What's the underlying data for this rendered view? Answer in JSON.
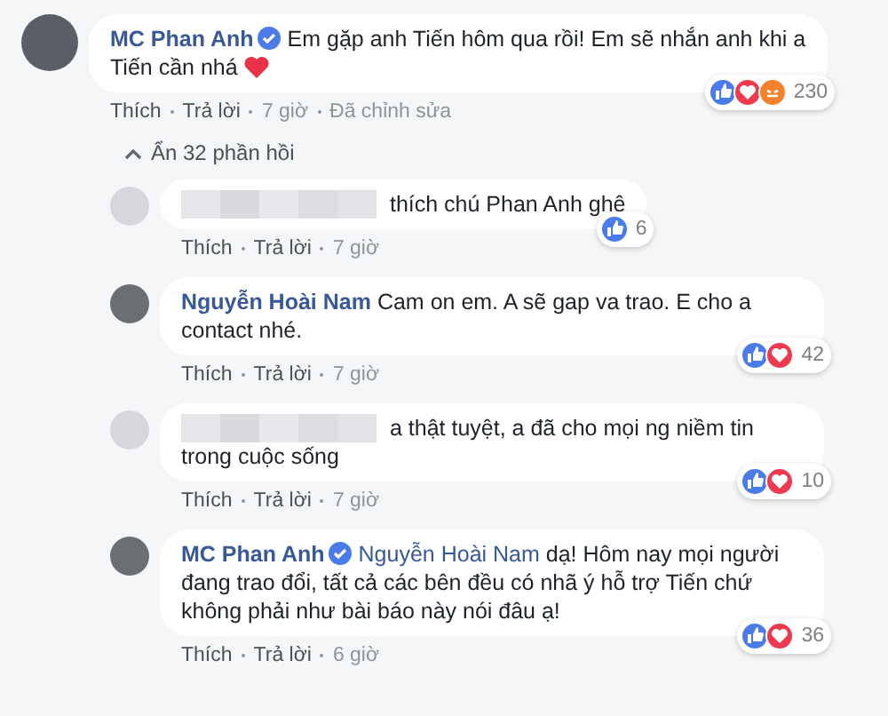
{
  "comments": [
    {
      "author": "MC Phan Anh",
      "verified": true,
      "text": "Em gặp anh Tiến hôm qua rồi! Em sẽ nhắn anh khi a Tiến cần nhá",
      "heart": true,
      "reactions": [
        {
          "kind": "like"
        },
        {
          "kind": "love"
        },
        {
          "kind": "angry"
        }
      ],
      "reaction_count": "230",
      "actions": [
        "Thích",
        "Trả lời",
        "7 giờ",
        "Đã chỉnh sửa"
      ],
      "toggle": "Ẩn 32 phần hồi",
      "children": [
        {
          "author_hidden": true,
          "text": "thích chú Phan Anh ghê",
          "reactions": [
            {
              "kind": "like"
            }
          ],
          "reaction_count": "6",
          "actions": [
            "Thích",
            "Trả lời",
            "7 giờ"
          ]
        },
        {
          "author": "Nguyễn Hoài Nam",
          "text": "Cam on em. A sẽ gap va trao. E cho a contact nhé.",
          "reactions": [
            {
              "kind": "like"
            },
            {
              "kind": "love"
            }
          ],
          "reaction_count": "42",
          "actions": [
            "Thích",
            "Trả lời",
            "7 giờ"
          ]
        },
        {
          "author_hidden": true,
          "text": "a thật tuyệt, a đã cho mọi ng niềm tin trong cuộc sống",
          "reactions": [
            {
              "kind": "like"
            },
            {
              "kind": "love"
            }
          ],
          "reaction_count": "10",
          "actions": [
            "Thích",
            "Trả lời",
            "7 giờ"
          ]
        },
        {
          "author": "MC Phan Anh",
          "verified": true,
          "mention": "Nguyễn Hoài Nam",
          "text": "dạ! Hôm nay mọi người đang trao đổi, tất cả các bên đều có nhã ý hỗ trợ Tiến chứ không phải như bài báo này nói đâu ạ!",
          "reactions": [
            {
              "kind": "like"
            },
            {
              "kind": "love"
            }
          ],
          "reaction_count": "36",
          "actions": [
            "Thích",
            "Trả lời",
            "6 giờ"
          ]
        }
      ]
    }
  ]
}
